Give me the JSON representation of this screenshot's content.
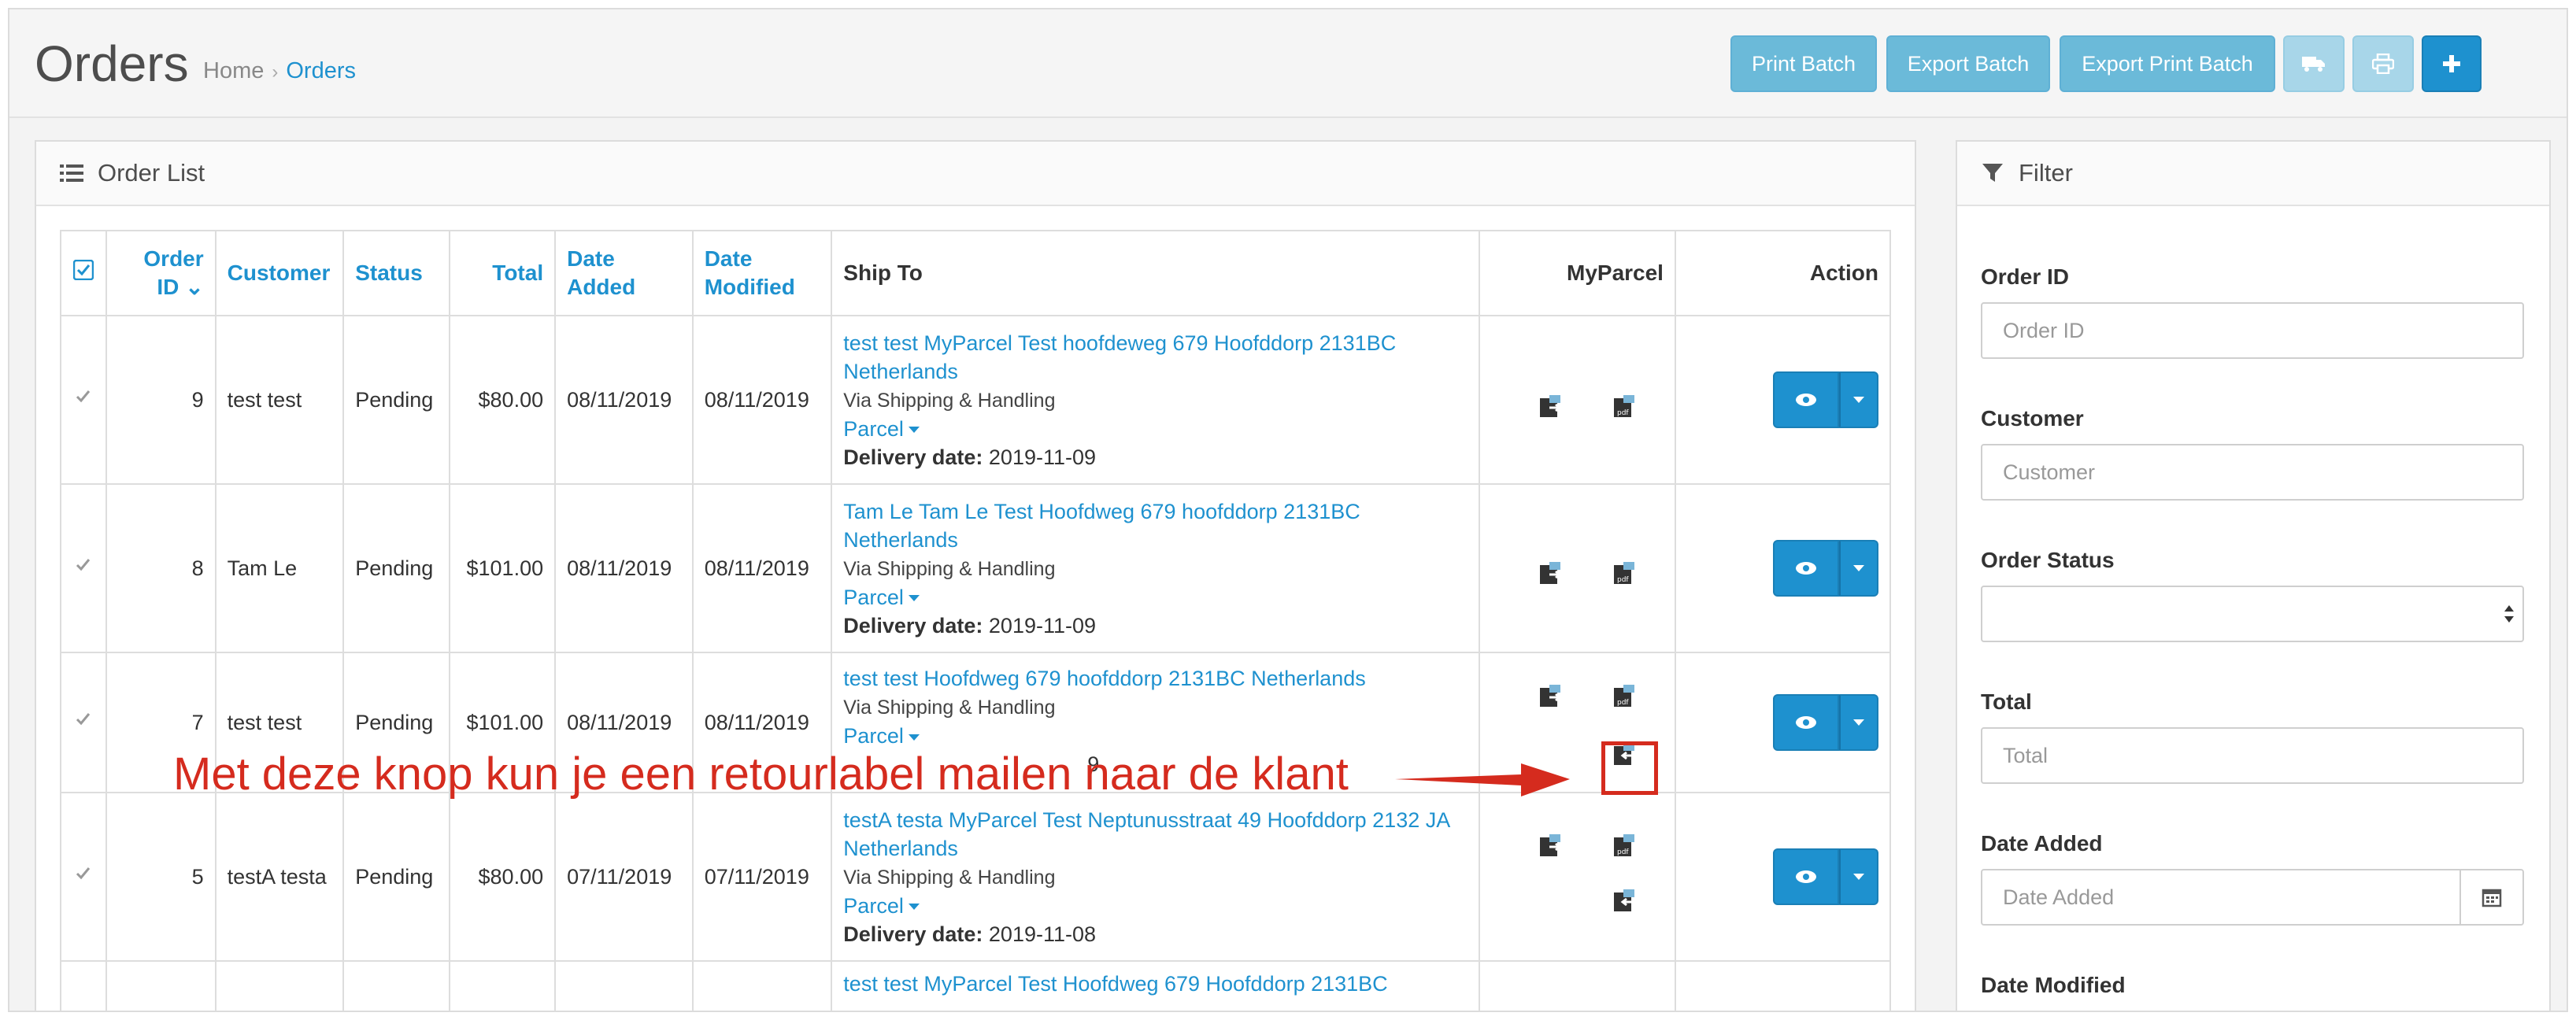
{
  "header": {
    "title": "Orders",
    "breadcrumb": {
      "home": "Home",
      "separator": "›",
      "current": "Orders"
    },
    "buttons": {
      "print_batch": "Print Batch",
      "export_batch": "Export Batch",
      "export_print_batch": "Export Print Batch",
      "truck_icon": "truck-icon",
      "print_icon": "print-icon",
      "add_icon": "plus-icon"
    }
  },
  "order_list": {
    "heading": "Order List",
    "columns": {
      "order_id": "Order ID",
      "customer": "Customer",
      "status": "Status",
      "total": "Total",
      "date_added": "Date Added",
      "date_modified": "Date Modified",
      "ship_to": "Ship To",
      "myparcel": "MyParcel",
      "action": "Action"
    },
    "rows": [
      {
        "order_id": "9",
        "customer": "test test",
        "status": "Pending",
        "total": "$80.00",
        "date_added": "08/11/2019",
        "date_modified": "08/11/2019",
        "ship_address": "test test MyParcel Test hoofdeweg 679 Hoofddorp 2131BC Netherlands",
        "shipping_method": "Via Shipping & Handling",
        "parcel": "Parcel",
        "delivery_label": "Delivery date:",
        "delivery_date": "2019-11-09"
      },
      {
        "order_id": "8",
        "customer": "Tam Le",
        "status": "Pending",
        "total": "$101.00",
        "date_added": "08/11/2019",
        "date_modified": "08/11/2019",
        "ship_address": "Tam Le Tam Le Test Hoofdweg 679 hoofddorp 2131BC Netherlands",
        "shipping_method": "Via Shipping & Handling",
        "parcel": "Parcel",
        "delivery_label": "Delivery date:",
        "delivery_date": "2019-11-09"
      },
      {
        "order_id": "7",
        "customer": "test test",
        "status": "Pending",
        "total": "$101.00",
        "date_added": "08/11/2019",
        "date_modified": "08/11/2019",
        "ship_address": "test test Hoofdweg 679 hoofddorp 2131BC Netherlands",
        "shipping_method": "Via Shipping & Handling",
        "parcel": "Parcel",
        "partial_date": "9"
      },
      {
        "order_id": "5",
        "customer": "testA testa",
        "status": "Pending",
        "total": "$80.00",
        "date_added": "07/11/2019",
        "date_modified": "07/11/2019",
        "ship_address": "testA testa MyParcel Test Neptunusstraat 49 Hoofddorp 2132 JA Netherlands",
        "shipping_method": "Via Shipping & Handling",
        "parcel": "Parcel",
        "delivery_label": "Delivery date:",
        "delivery_date": "2019-11-08"
      },
      {
        "ship_address": "test test MyParcel Test Hoofdweg 679 Hoofddorp 2131BC"
      }
    ]
  },
  "filter": {
    "heading": "Filter",
    "order_id_label": "Order ID",
    "order_id_placeholder": "Order ID",
    "customer_label": "Customer",
    "customer_placeholder": "Customer",
    "order_status_label": "Order Status",
    "total_label": "Total",
    "total_placeholder": "Total",
    "date_added_label": "Date Added",
    "date_added_placeholder": "Date Added",
    "date_modified_label": "Date Modified"
  },
  "annotation": {
    "text": "Met deze knop kun je een retourlabel mailen naar de klant"
  },
  "colors": {
    "accent": "#1e91cf",
    "button_info": "#6bbad9",
    "annotation_red": "#d52b1e"
  }
}
